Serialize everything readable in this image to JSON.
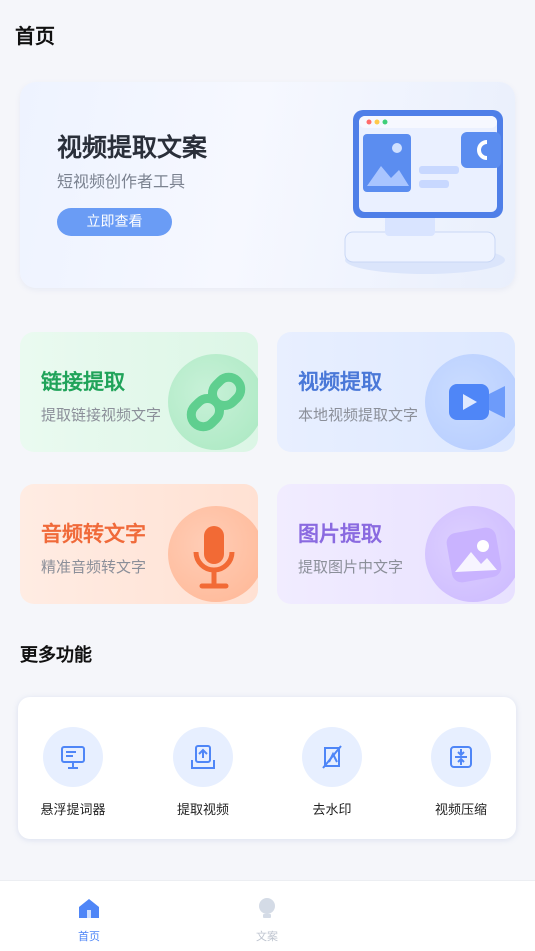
{
  "header": {
    "title": "首页"
  },
  "banner": {
    "title": "视频提取文案",
    "subtitle": "短视频创作者工具",
    "button_label": "立即查看"
  },
  "cards": {
    "link": {
      "title": "链接提取",
      "subtitle": "提取链接视频文字",
      "icon": "link-icon",
      "color": "#20a35a"
    },
    "video": {
      "title": "视频提取",
      "subtitle": "本地视频提取文字",
      "icon": "video-camera-icon",
      "color": "#4a78d8"
    },
    "audio": {
      "title": "音频转文字",
      "subtitle": "精准音频转文字",
      "icon": "microphone-icon",
      "color": "#f06a3a"
    },
    "image": {
      "title": "图片提取",
      "subtitle": "提取图片中文字",
      "icon": "image-icon",
      "color": "#8a6ae0"
    }
  },
  "more": {
    "title": "更多功能",
    "tools": [
      {
        "label": "悬浮提词器",
        "icon": "teleprompter-icon"
      },
      {
        "label": "提取视频",
        "icon": "upload-icon"
      },
      {
        "label": "去水印",
        "icon": "no-watermark-icon"
      },
      {
        "label": "视频压缩",
        "icon": "compress-icon"
      }
    ]
  },
  "tabbar": {
    "items": [
      {
        "label": "首页",
        "icon": "home-icon",
        "active": true
      },
      {
        "label": "文案",
        "icon": "bulb-icon",
        "active": false
      }
    ]
  },
  "accent_color": "#4f86f7"
}
